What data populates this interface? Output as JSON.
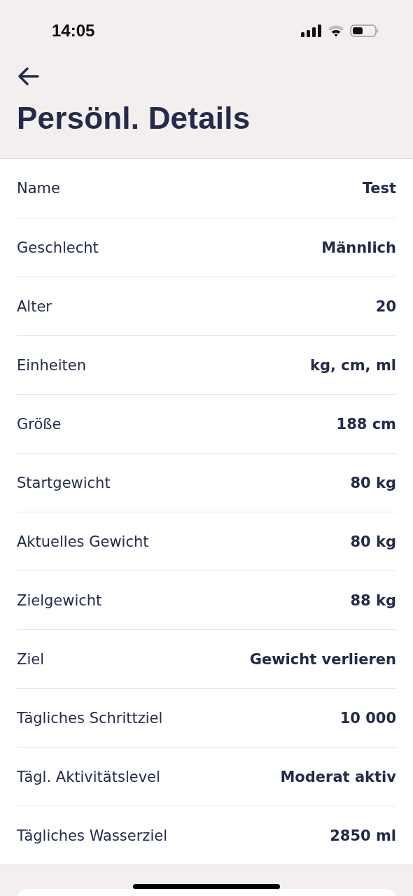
{
  "status_bar": {
    "time": "14:05"
  },
  "title": "Persönl. Details",
  "rows": [
    {
      "label": "Name",
      "value": "Test"
    },
    {
      "label": "Geschlecht",
      "value": "Männlich"
    },
    {
      "label": "Alter",
      "value": "20"
    },
    {
      "label": "Einheiten",
      "value": "kg, cm, ml"
    },
    {
      "label": "Größe",
      "value": "188 cm"
    },
    {
      "label": "Startgewicht",
      "value": "80 kg"
    },
    {
      "label": "Aktuelles Gewicht",
      "value": "80 kg"
    },
    {
      "label": "Zielgewicht",
      "value": "88 kg"
    },
    {
      "label": "Ziel",
      "value": "Gewicht verlieren"
    },
    {
      "label": "Tägliches Schrittziel",
      "value": "10 000"
    },
    {
      "label": "Tägl. Aktivitätslevel",
      "value": "Moderat aktiv"
    },
    {
      "label": "Tägliches Wasserziel",
      "value": "2850 ml"
    }
  ]
}
